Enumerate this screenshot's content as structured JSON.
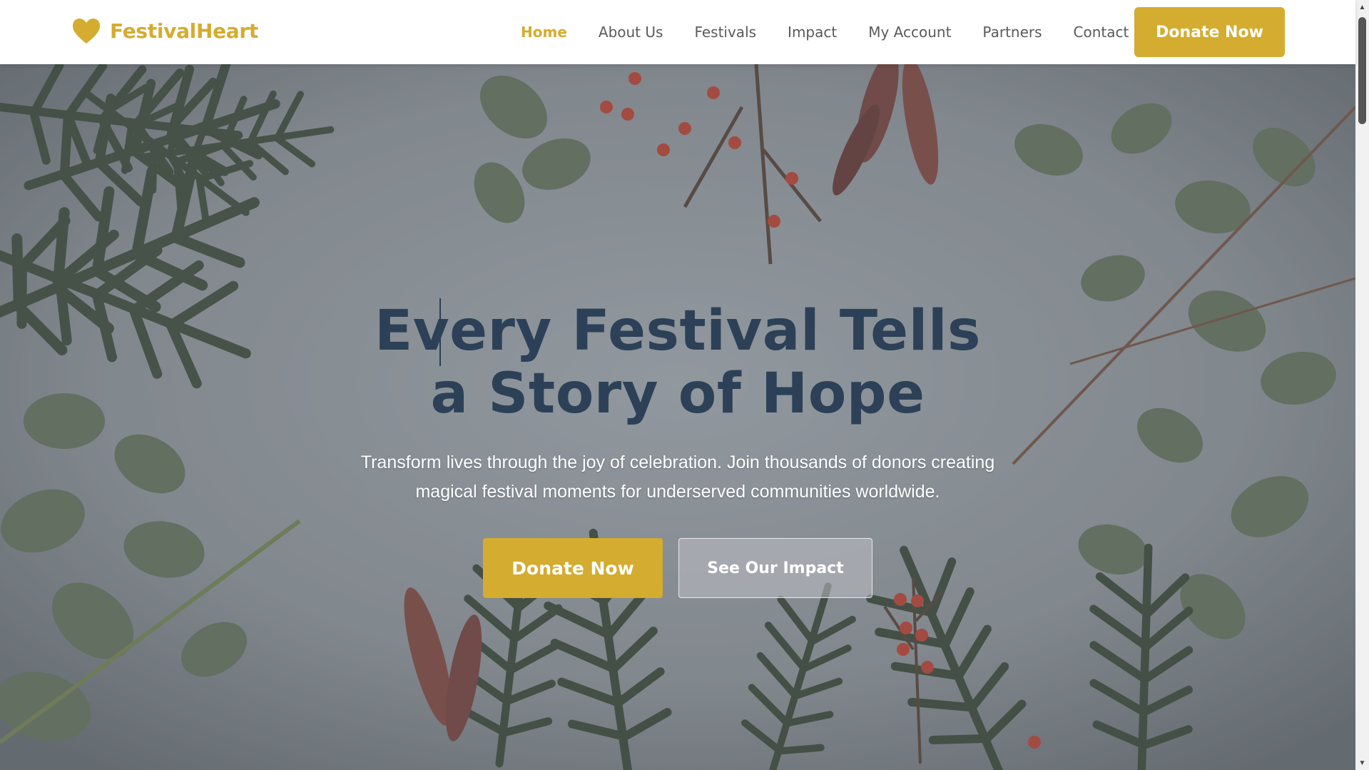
{
  "brand": {
    "name": "FestivalHeart",
    "icon": "heart-icon",
    "color": "#d4ac2f"
  },
  "nav": {
    "items": [
      {
        "label": "Home",
        "active": true
      },
      {
        "label": "About Us",
        "active": false
      },
      {
        "label": "Festivals",
        "active": false
      },
      {
        "label": "Impact",
        "active": false
      },
      {
        "label": "My Account",
        "active": false
      },
      {
        "label": "Partners",
        "active": false
      },
      {
        "label": "Contact",
        "active": false
      }
    ],
    "cta": "Donate Now"
  },
  "hero": {
    "title_line1": "Every Festival Tells",
    "title_line2": "a Story of Hope",
    "subtitle": "Transform lives through the joy of celebration. Join thousands of donors creating magical festival moments for underserved communities worldwide.",
    "primary_button": "Donate Now",
    "secondary_button": "See Our Impact"
  },
  "colors": {
    "accent": "#d4ac2f",
    "title": "#2c4157",
    "nav_text": "#5a5a5a"
  }
}
